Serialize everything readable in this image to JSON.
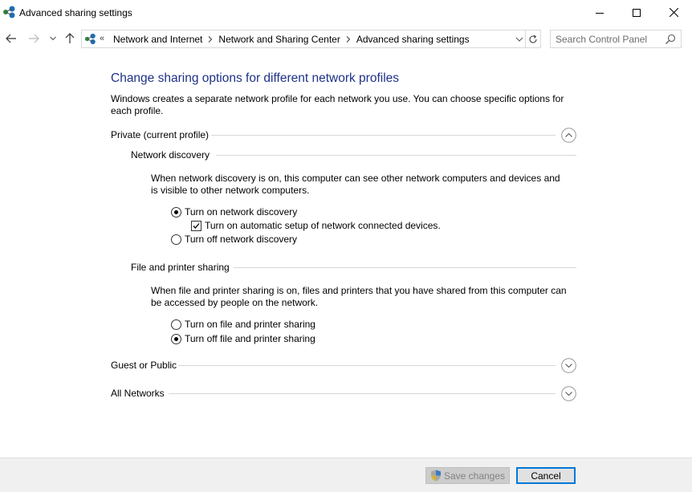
{
  "window": {
    "title": "Advanced sharing settings"
  },
  "nav": {
    "overflow": "«",
    "breadcrumbs": [
      "Network and Internet",
      "Network and Sharing Center",
      "Advanced sharing settings"
    ],
    "search_placeholder": "Search Control Panel"
  },
  "page": {
    "heading": "Change sharing options for different network profiles",
    "intro": "Windows creates a separate network profile for each network you use. You can choose specific options for each profile."
  },
  "profiles": {
    "private": {
      "label": "Private (current profile)",
      "expanded": true,
      "network_discovery": {
        "label": "Network discovery",
        "description": "When network discovery is on, this computer can see other network computers and devices and is visible to other network computers.",
        "option_on": "Turn on network discovery",
        "option_auto": "Turn on automatic setup of network connected devices.",
        "option_off": "Turn off network discovery",
        "selected": "on",
        "auto_checked": true
      },
      "file_printer_sharing": {
        "label": "File and printer sharing",
        "description": "When file and printer sharing is on, files and printers that you have shared from this computer can be accessed by people on the network.",
        "option_on": "Turn on file and printer sharing",
        "option_off": "Turn off file and printer sharing",
        "selected": "off"
      }
    },
    "guest": {
      "label": "Guest or Public",
      "expanded": false
    },
    "all": {
      "label": "All Networks",
      "expanded": false
    }
  },
  "footer": {
    "save_label": "Save changes",
    "cancel_label": "Cancel"
  },
  "colors": {
    "heading": "#1e3287",
    "accent": "#0078d7",
    "footer_bg": "#f0f0f0"
  }
}
